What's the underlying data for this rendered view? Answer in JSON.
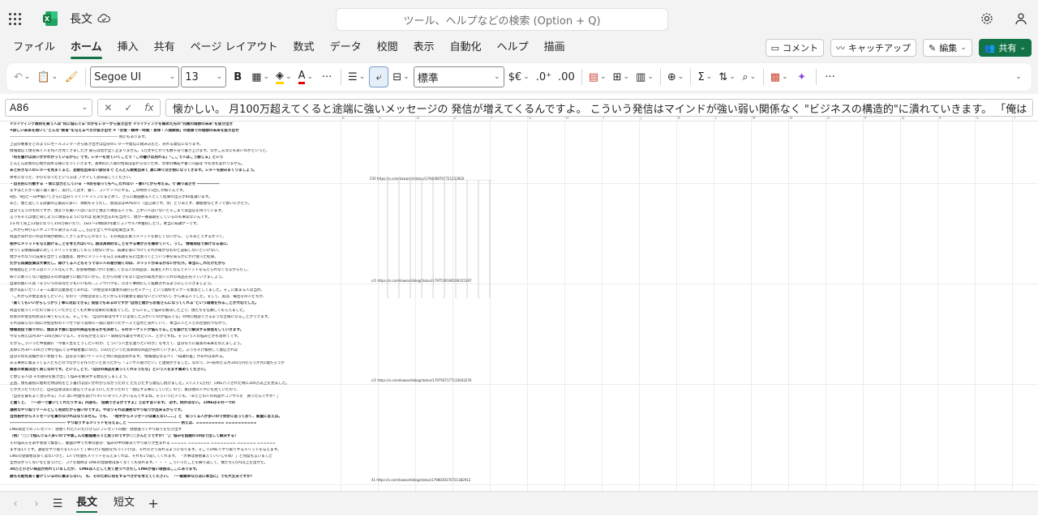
{
  "app": {
    "doc_title": "長文",
    "search_placeholder": "ツール、ヘルプなどの検索 (Option + Q)"
  },
  "tabs": [
    "ファイル",
    "ホーム",
    "挿入",
    "共有",
    "ページ レイアウト",
    "数式",
    "データ",
    "校閲",
    "表示",
    "自動化",
    "ヘルプ",
    "描画"
  ],
  "active_tab": "ホーム",
  "tab_actions": {
    "comment": "コメント",
    "catchup": "キャッチアップ",
    "edit": "編集",
    "share": "共有"
  },
  "toolbar": {
    "font": "Segoe UI",
    "size": "13",
    "number_format": "標準",
    "currency": "$€"
  },
  "formula_bar": {
    "cell": "A86",
    "fx": "fx",
    "content": "懐かしい。 月100万超えてくると途端に強いメッセージの 発信が増えてくるんですよ。 こういう発信はマインドが強い弱い関係なく \"ビジネスの構造的\"に潰れていきます。 「俺は"
  },
  "sheet": {
    "columns": [
      "B",
      "C",
      "D",
      "E",
      "F",
      "G",
      "H",
      "I",
      "J",
      "K",
      "L",
      "M",
      "N",
      "O",
      "P",
      "Q",
      "R",
      "S",
      "T",
      "U"
    ],
    "colA_lines": [
      "②ライティング教材を買う人は\"何に悩んでる\"のかをレターから抜き出せ ③ライティングを極めた先の\"究極の理想の未来\"を抜き出せ",
      "④欲しい未来を抱いて\"どんな\"教育\"を与えるべきか抜き出せ ⑤「お金・精神・時間・身体・人間関係」の要素での理想の未来を抜き出せ",
      "――――――――――――――――――――――――――――― 例にもあります。",
      "上記の要素をどのようにセールスレターから抜き出せば自分のレターや発信に組み込むと、売れる発信になります。",
      "情報発信で僕を稼ぐ人を何人か見てきましたが 彼らは皆が全く止まりません。1万文字とかでも数十分で書き上げます。なぜこんなにも早いのかというと、",
      "「何を書けば良いかがわかっているから」です。レターを見ていくことで「この書けば売れる」「ここで人はこう感じる」という",
      "どんどん読者の心情が読める様になっていきます。基本的に人間の性質は変わらないため、文章の構成や書く内容は 今も昔も変わりません。",
      "あと好きな人のレターを見まくると、言語化出来ない部分まで どんどん感覚出来て 凄に降り注ぎ始になってきます。レターを読みまくりましょう。",
      "参考になった、学びになったという方は ブクマして読み返してください。",
      "・自主的に行動する ・常に全力としている ・0点を取ってもへこたれない ・動いてから考える。で 繰り返させ ――――――",
      "まずはとにかく聞く聞く聞く、実行して話す、書く、コンテンツにする。この時点で1回しか稼ぐんです。",
      "8回、9回と一日中聞いてさらに自分でマインドマップにまとめて、さらに動画観る人として結果の出方が80度違います。",
      "あと、僕と話してる読書の言葉前に多い、添削もそうだし、感覚ほぼ90%ので（自己満です。笑）とりあえず、番組会などオフで会いにきたり。",
      "自分で言うのも何ですが、僕よりも賢い人はいるけど僕より頑張る人でも、上手い人はいないとそこまでは自信を持っています。",
      "言っちゃえば僕と同じように頑張るようになれば 結果が出るのも当然で、僕が一番最期をしているのも事実ないんです。",
      "1ヶ月で売上12倍になって350万稼いだり、1日1〜2時間の作業でコンサル7件獲得したり。本当に知識ゲーです。",
      "これから伸びる人やコンサル受ける人は こころ辺を全てやれば結果出ます。",
      "商品が売れないのは市場が飽和してきてるからじゃなくて、その商品を買うメリットを感じてないから。 じゃあどうするかって、",
      "相手にメリットを与え続けることを考えればいい。困は具体的なことをやる事が方を極めていく、って。 情報発信で稼げなる為に、",
      "持ってる情報知識に対してメリットを感じてもらう他ないから、知識を身につけてそれが確かなものと認知しないといけない。",
      "僕がそれなりに成果を出せてる理由は、相手にメリットを与える知識を先に出会ってどういう事を知るかにかけ使った結果。",
      "だから知識投資は大事だし、稼げてる人ともそうでない人の差が開くのは、メリットがあるかないかだけ。本当にこれだけだから",
      "情報発信ビジネスはシンプルなんです。お客様視聴いかにも嬉しくなる人の商品は、知識を入れてなんでメリットを与えられなくなるからだし、",
      "稼ぐに拠ってない理由はその原理通りに動けないから。だから何者でもない自分の知見が思い入れの商品を売っていきましょう。",
      "自身の無い人は「そういうのあなたでもいいもの…」ノウハウを、小さく事例にして拡散されるようにしていきましょう。",
      "僕が以前いたリフォーム業の営業会社であれば、「外壁塗装の業者の選び方セミナー」という無料セミナーを集客としてました。そこに集まる人は当然、",
      "「これから外壁塗装をしたい人」なので「外壁塗装をしたいからその業者を選ばないといけない」から来る人でした。そして、実は、毎回その人たちが、",
      "「高くてもいいからしっかり丁寧に対応できる」発信でもあるのですが\"自然と僕からお客さんになってくれる\"という環境を作ることが大切でした。",
      "商品を扱っていたので知っていたけどとても大事な効果的な集客でした。さらにそこで悩みを解決した上で、僕たちを信頼してもらえました。",
      "お客の外壁塗料状況に来てもらえる。そこでも、「自分の家は今すぐに塗装した方がいいのか悩んでる」の時に相談できるような立場になることができます。",
      "それは知らない間に外壁塗料のトリセツ形で実際に一般に加わったケースで自然と売れていく、本当に人と人との社会的つながり。",
      "情報発信で稼ぐのに、僕はまず誰に自分の商品を売るかを決めて、そのターゲットが悩んでることを届けたり解決する発信をしていきます。",
      "今なら例えば月30〜100万稼いでる人、その先が見えない・単純な作業をやめたい人、とかですね。そういう人の悩みとかも含めてです。",
      "だからこういった中長期に「今後人生をどうしたいのか、どういう人生を送りたいのか」を考えて、自分なりに最高の未来を伝えましょう。",
      "実際に月30〜100万で伸び悩んでる中級者層に50万、150万といった高単価な商品が売れていきました。ぶっちゃけ集約して発信されば",
      "自分に何も実績がない状態でも、自分より賢いテーマ人と共に商品は売れます。 情報発信なるべく「知識の差」があれば売れる。",
      "ある事例に集まってる人たちとのつながりを作りたいと思ったから「コンサル受けたい」と連絡がきました。なので、0→初めたる月100万円だろうが月1億だろうが",
      "集客の本質は全く同じなのです。ということで、「自分の商品を買ってくれそうだな」という人をまず集めてください。",
      "と想じる人は その部分を抜き出して悩みを解決する発信をしましょう。",
      "正直、僕も最初に始めた時は何をどう書けば良いかわからなかったので ただひたすら発信し続けました。1リスト1万円！ LINEパンされた時に300万以上を見ました。",
      "とか大ったりだけど、自分自身は常に発信できるようにしたかったので「発信する事にしていた」ので、後は他の人やにも見ていたので、",
      "「自分を最もよく見られる」人に 高い利益も良けりゃいいぞって人がいるんですよね。そういった人でも、「あとどの人の商品やコンサルを　買ったんですか？」",
      "と聞くと、 「一対一で書いてくれたりする」内容も、 信頼できるかですよ」と必ず言います。 必ず。例外はない。 LINEはその一つの",
      "濃密なやり取りツールとして有効だから強いのですよ。やはりそれは濃密なやり取りが出来るからです。",
      "当然相手からメッセージを貰わなければなりません。でも、 「相手からメッセージは貰えない……」と　知ってる人が多いので余計に言っておく、質量に言えば。",
      "――――――――――――――― やり取りするメリットを与えること ―――――――――――――― 例えば、========= ==========",
      "LINE限定でのプレゼント：感想くれた人にだけさらにプレゼント同梱：感想送ってやり取りを引き出す",
      "（例）\"○○で悩んでる人多いので今僕こんな動画撮ろうと思うのですが○○さんどうですか？\"」：悩みを話題の10倍で出して解決する！",
      "その悩み方を表す感覚で集客し、動画の中で大事な部分：悩みの中の解決でやり取りが生まれる ===== ======= ======== ====== ======",
      "まずは1人です。濃密なやり取りを1人1人で丁寧に行い個別を作っていけば、それだけで売れるようになります。そこでLINEでやり取りするメリットを与えます。",
      "LINEの登録者は多くはないけど、1人で何個もメリットを与えまくれば、それも1つ返してくれます。 「大事は感想貰えていいじゃね！」と何度も言いました",
      "全然分かってないなと思うけど、コツを掴めば LINEの登録者は多くなくても売れます。・ ・ ・ こういったことを繰り返して、僕たち1万円以上を出せた。",
      "30万と小さい商品が売れていましたが、 LINEは人として見て使うべきだし LINEが強い理由はここにあります。",
      "誰も可能性高く書けているのに集まらない。 も、そのために何をするべきかを考えてください。 「一番簡単な方法に本当に」でも大丈夫ですか？"
    ],
    "links": [
      "530 https://x.com/kawachi/status/1794008707721233920",
      "c/1 https://x.com/kawachiblog/status/1797519190206315297",
      "c/1 https://x.com/kawachiblog/status/1797567177133043276",
      "41 https://x.com/kawachiblog/status/1798030370721382912"
    ]
  },
  "sheets": [
    "長文",
    "短文"
  ],
  "active_sheet": "長文",
  "colors": {
    "accent": "#117346"
  }
}
